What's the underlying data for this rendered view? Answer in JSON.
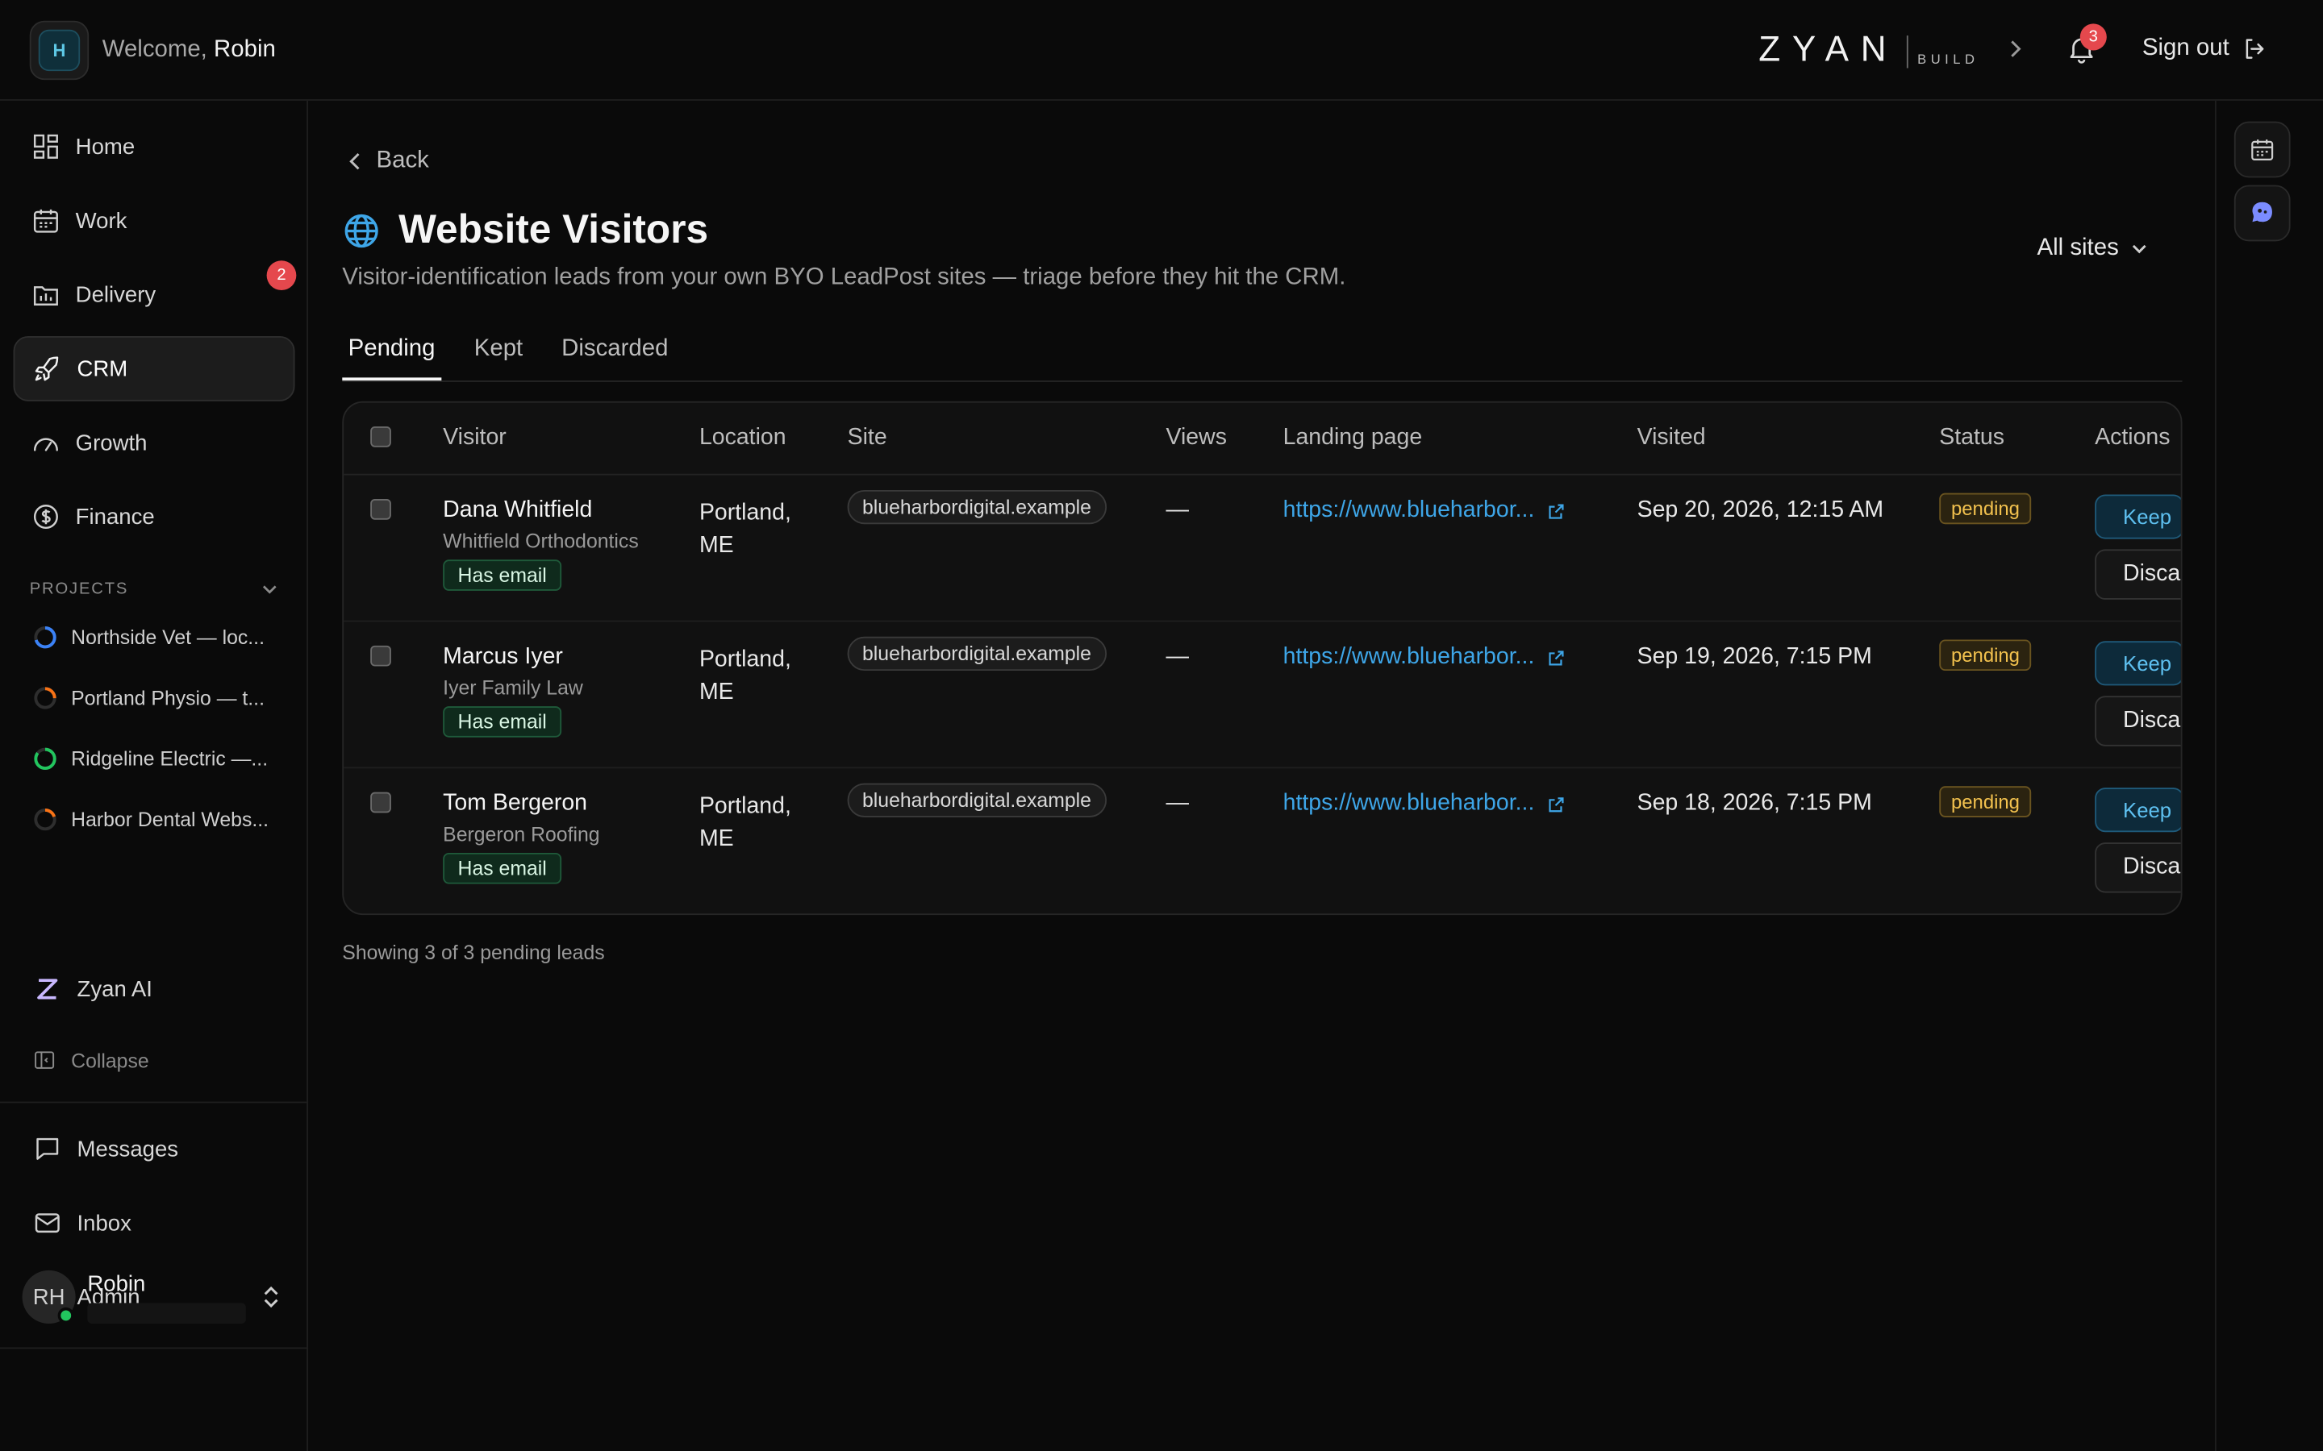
{
  "header": {
    "workspace_initial": "H",
    "welcome_prefix": "Welcome,",
    "user_first": "Robin",
    "brand_word": "ZYAN",
    "brand_sub": "BUILD",
    "notification_count": "3",
    "sign_out_label": "Sign out"
  },
  "sidebar": {
    "nav": [
      {
        "label": "Home",
        "icon": "home-grid-icon"
      },
      {
        "label": "Work",
        "icon": "calendar-icon"
      },
      {
        "label": "Delivery",
        "icon": "folder-chart-icon",
        "badge": "2"
      },
      {
        "label": "CRM",
        "icon": "rocket-icon",
        "active": true
      },
      {
        "label": "Growth",
        "icon": "gauge-icon"
      },
      {
        "label": "Finance",
        "icon": "dollar-coin-icon"
      }
    ],
    "projects_heading": "PROJECTS",
    "projects": [
      {
        "label": "Northside Vet — loc...",
        "color": "#3b82f6",
        "progress": 0.7
      },
      {
        "label": "Portland Physio — t...",
        "color": "#f97316",
        "progress": 0.25
      },
      {
        "label": "Ridgeline Electric —...",
        "color": "#22c55e",
        "progress": 0.85
      },
      {
        "label": "Harbor Dental Webs...",
        "color": "#f97316",
        "progress": 0.2
      }
    ],
    "zyan_ai_label": "Zyan AI",
    "collapse_label": "Collapse",
    "bottom": [
      {
        "label": "Messages",
        "icon": "message-square-icon"
      },
      {
        "label": "Inbox",
        "icon": "mail-icon"
      },
      {
        "label": "Admin",
        "icon": "gear-icon"
      }
    ],
    "user": {
      "initials": "RH",
      "name": "Robin"
    }
  },
  "main": {
    "back_label": "Back",
    "title": "Website Visitors",
    "subtitle": "Visitor-identification leads from your own BYO LeadPost sites — triage before they hit the CRM.",
    "site_filter": "All sites",
    "tabs": [
      "Pending",
      "Kept",
      "Discarded"
    ],
    "active_tab": "Pending",
    "table": {
      "headers": [
        "Visitor",
        "Location",
        "Site",
        "Views",
        "Landing page",
        "Visited",
        "Status",
        "Actions"
      ],
      "rows": [
        {
          "name": "Dana Whitfield",
          "company": "Whitfield Orthodontics",
          "tag": "Has email",
          "city": "Portland,",
          "state": "ME",
          "site": "blueharbordigital.example",
          "views": "—",
          "landing": "https://www.blueharbor...",
          "visited": "Sep 20, 2026, 12:15 AM",
          "status": "pending",
          "keep": "Keep",
          "discard": "Discard"
        },
        {
          "name": "Marcus Iyer",
          "company": "Iyer Family Law",
          "tag": "Has email",
          "city": "Portland,",
          "state": "ME",
          "site": "blueharbordigital.example",
          "views": "—",
          "landing": "https://www.blueharbor...",
          "visited": "Sep 19, 2026, 7:15 PM",
          "status": "pending",
          "keep": "Keep",
          "discard": "Discard"
        },
        {
          "name": "Tom Bergeron",
          "company": "Bergeron Roofing",
          "tag": "Has email",
          "city": "Portland,",
          "state": "ME",
          "site": "blueharbordigital.example",
          "views": "—",
          "landing": "https://www.blueharbor...",
          "visited": "Sep 18, 2026, 7:15 PM",
          "status": "pending",
          "keep": "Keep",
          "discard": "Discard"
        }
      ]
    },
    "footnote": "Showing 3 of 3 pending leads"
  },
  "rail": [
    {
      "icon": "calendar-icon"
    },
    {
      "icon": "ai-assistant-icon"
    }
  ],
  "colors": {
    "accent_link": "#3ea6e8",
    "danger_badge": "#e5484d",
    "status_pending": "#f2c14e",
    "success": "#22c55e"
  }
}
